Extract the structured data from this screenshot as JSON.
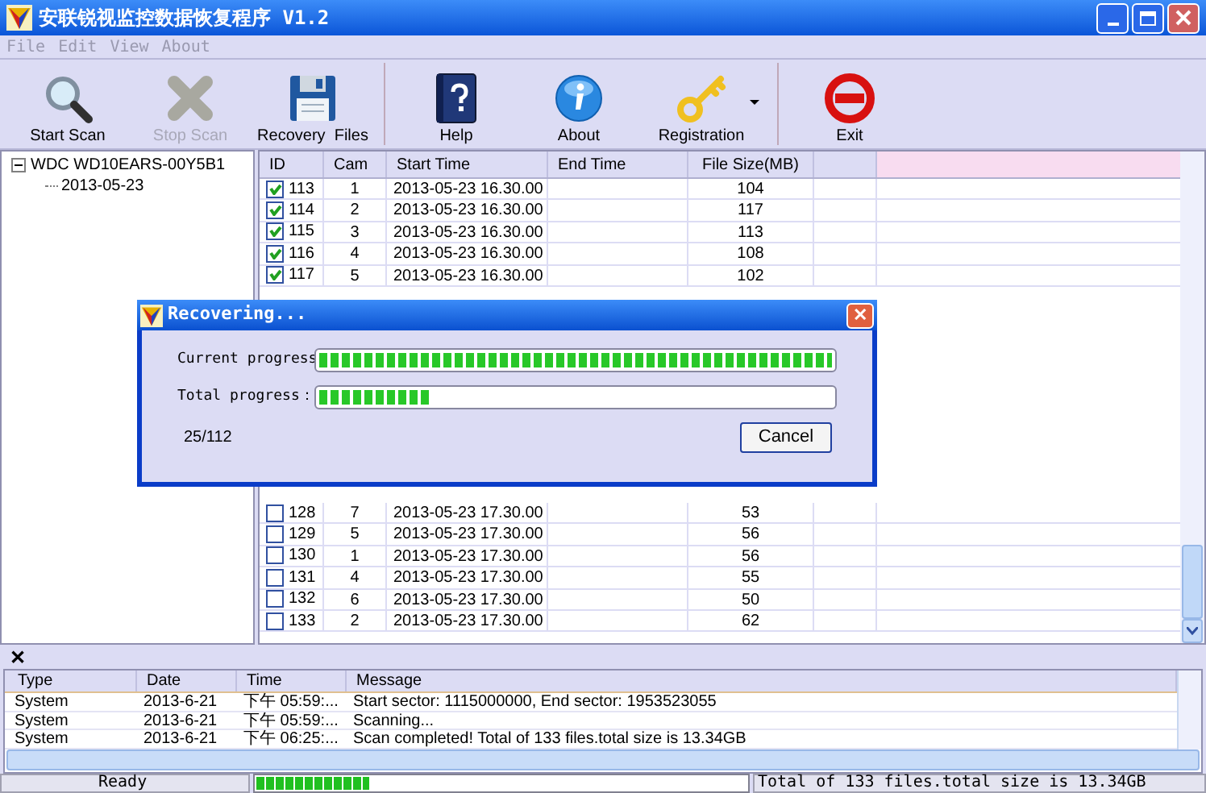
{
  "window": {
    "title": "安联锐视监控数据恢复程序 V1.2"
  },
  "menu": [
    {
      "label": "File",
      "disabled": true
    },
    {
      "label": "Edit",
      "disabled": true
    },
    {
      "label": "View",
      "disabled": true
    },
    {
      "label": "About",
      "disabled": true
    }
  ],
  "toolbar": [
    {
      "kind": "magnifier",
      "label": "Start Scan",
      "disabled": false
    },
    {
      "kind": "cross",
      "label": "Stop Scan",
      "disabled": true
    },
    {
      "kind": "floppy",
      "label": "Recovery  Files",
      "disabled": false,
      "separator_after": true
    },
    {
      "kind": "book",
      "label": "Help",
      "disabled": false
    },
    {
      "kind": "info",
      "label": "About",
      "disabled": false
    },
    {
      "kind": "key",
      "label": "Registration",
      "disabled": false,
      "dropdown": true,
      "separator_after": true
    },
    {
      "kind": "stop",
      "label": "Exit",
      "disabled": false
    }
  ],
  "tree": [
    {
      "label": "WDC WD10EARS-00Y5B1",
      "expanded": true,
      "children": [
        {
          "label": "2013-05-23"
        }
      ]
    }
  ],
  "table": {
    "columns": [
      "ID",
      "Cam",
      "Start Time",
      "End Time",
      "File Size(MB)"
    ],
    "rows": [
      {
        "checked": true,
        "id": "113",
        "cam": "1",
        "start": "2013-05-23 16.30.00",
        "size": "104"
      },
      {
        "checked": true,
        "id": "114",
        "cam": "2",
        "start": "2013-05-23 16.30.00",
        "size": "117"
      },
      {
        "checked": true,
        "id": "115",
        "cam": "3",
        "start": "2013-05-23 16.30.00",
        "size": "113"
      },
      {
        "checked": true,
        "id": "116",
        "cam": "4",
        "start": "2013-05-23 16.30.00",
        "size": "108"
      },
      {
        "checked": true,
        "id": "117",
        "cam": "5",
        "start": "2013-05-23 16.30.00",
        "size": "102"
      },
      {
        "checked": false,
        "id": "128",
        "cam": "7",
        "start": "2013-05-23 17.30.00",
        "size": "53"
      },
      {
        "checked": false,
        "id": "129",
        "cam": "5",
        "start": "2013-05-23 17.30.00",
        "size": "56"
      },
      {
        "checked": false,
        "id": "130",
        "cam": "1",
        "start": "2013-05-23 17.30.00",
        "size": "56"
      },
      {
        "checked": false,
        "id": "131",
        "cam": "4",
        "start": "2013-05-23 17.30.00",
        "size": "55"
      },
      {
        "checked": false,
        "id": "132",
        "cam": "6",
        "start": "2013-05-23 17.30.00",
        "size": "50"
      },
      {
        "checked": false,
        "id": "133",
        "cam": "2",
        "start": "2013-05-23 17.30.00",
        "size": "62"
      }
    ]
  },
  "dialog": {
    "title": "Recovering...",
    "close": "✕",
    "bars": [
      {
        "label": "Current progress",
        "level": 1.0
      },
      {
        "label": "Total progress：",
        "level": 0.22
      }
    ],
    "count": "25/112",
    "button": "Cancel"
  },
  "log": {
    "close": "✕",
    "columns": [
      "Type",
      "Date",
      "Time",
      "Message"
    ],
    "rows": [
      {
        "type": "System",
        "date": "2013-6-21",
        "time": "下午 05:59:...",
        "message": "Start sector: 1115000000, End sector: 1953523055"
      },
      {
        "type": "System",
        "date": "2013-6-21",
        "time": "下午 05:59:...",
        "message": "Scanning..."
      },
      {
        "type": "System",
        "date": "2013-6-21",
        "time": "下午 06:25:...",
        "message": "Scan completed! Total of 133 files.total size is 13.34GB"
      }
    ]
  },
  "status_bar": {
    "state": "Ready",
    "level": 0.23,
    "summary": "Total of 133 files.total size is 13.34GB"
  }
}
